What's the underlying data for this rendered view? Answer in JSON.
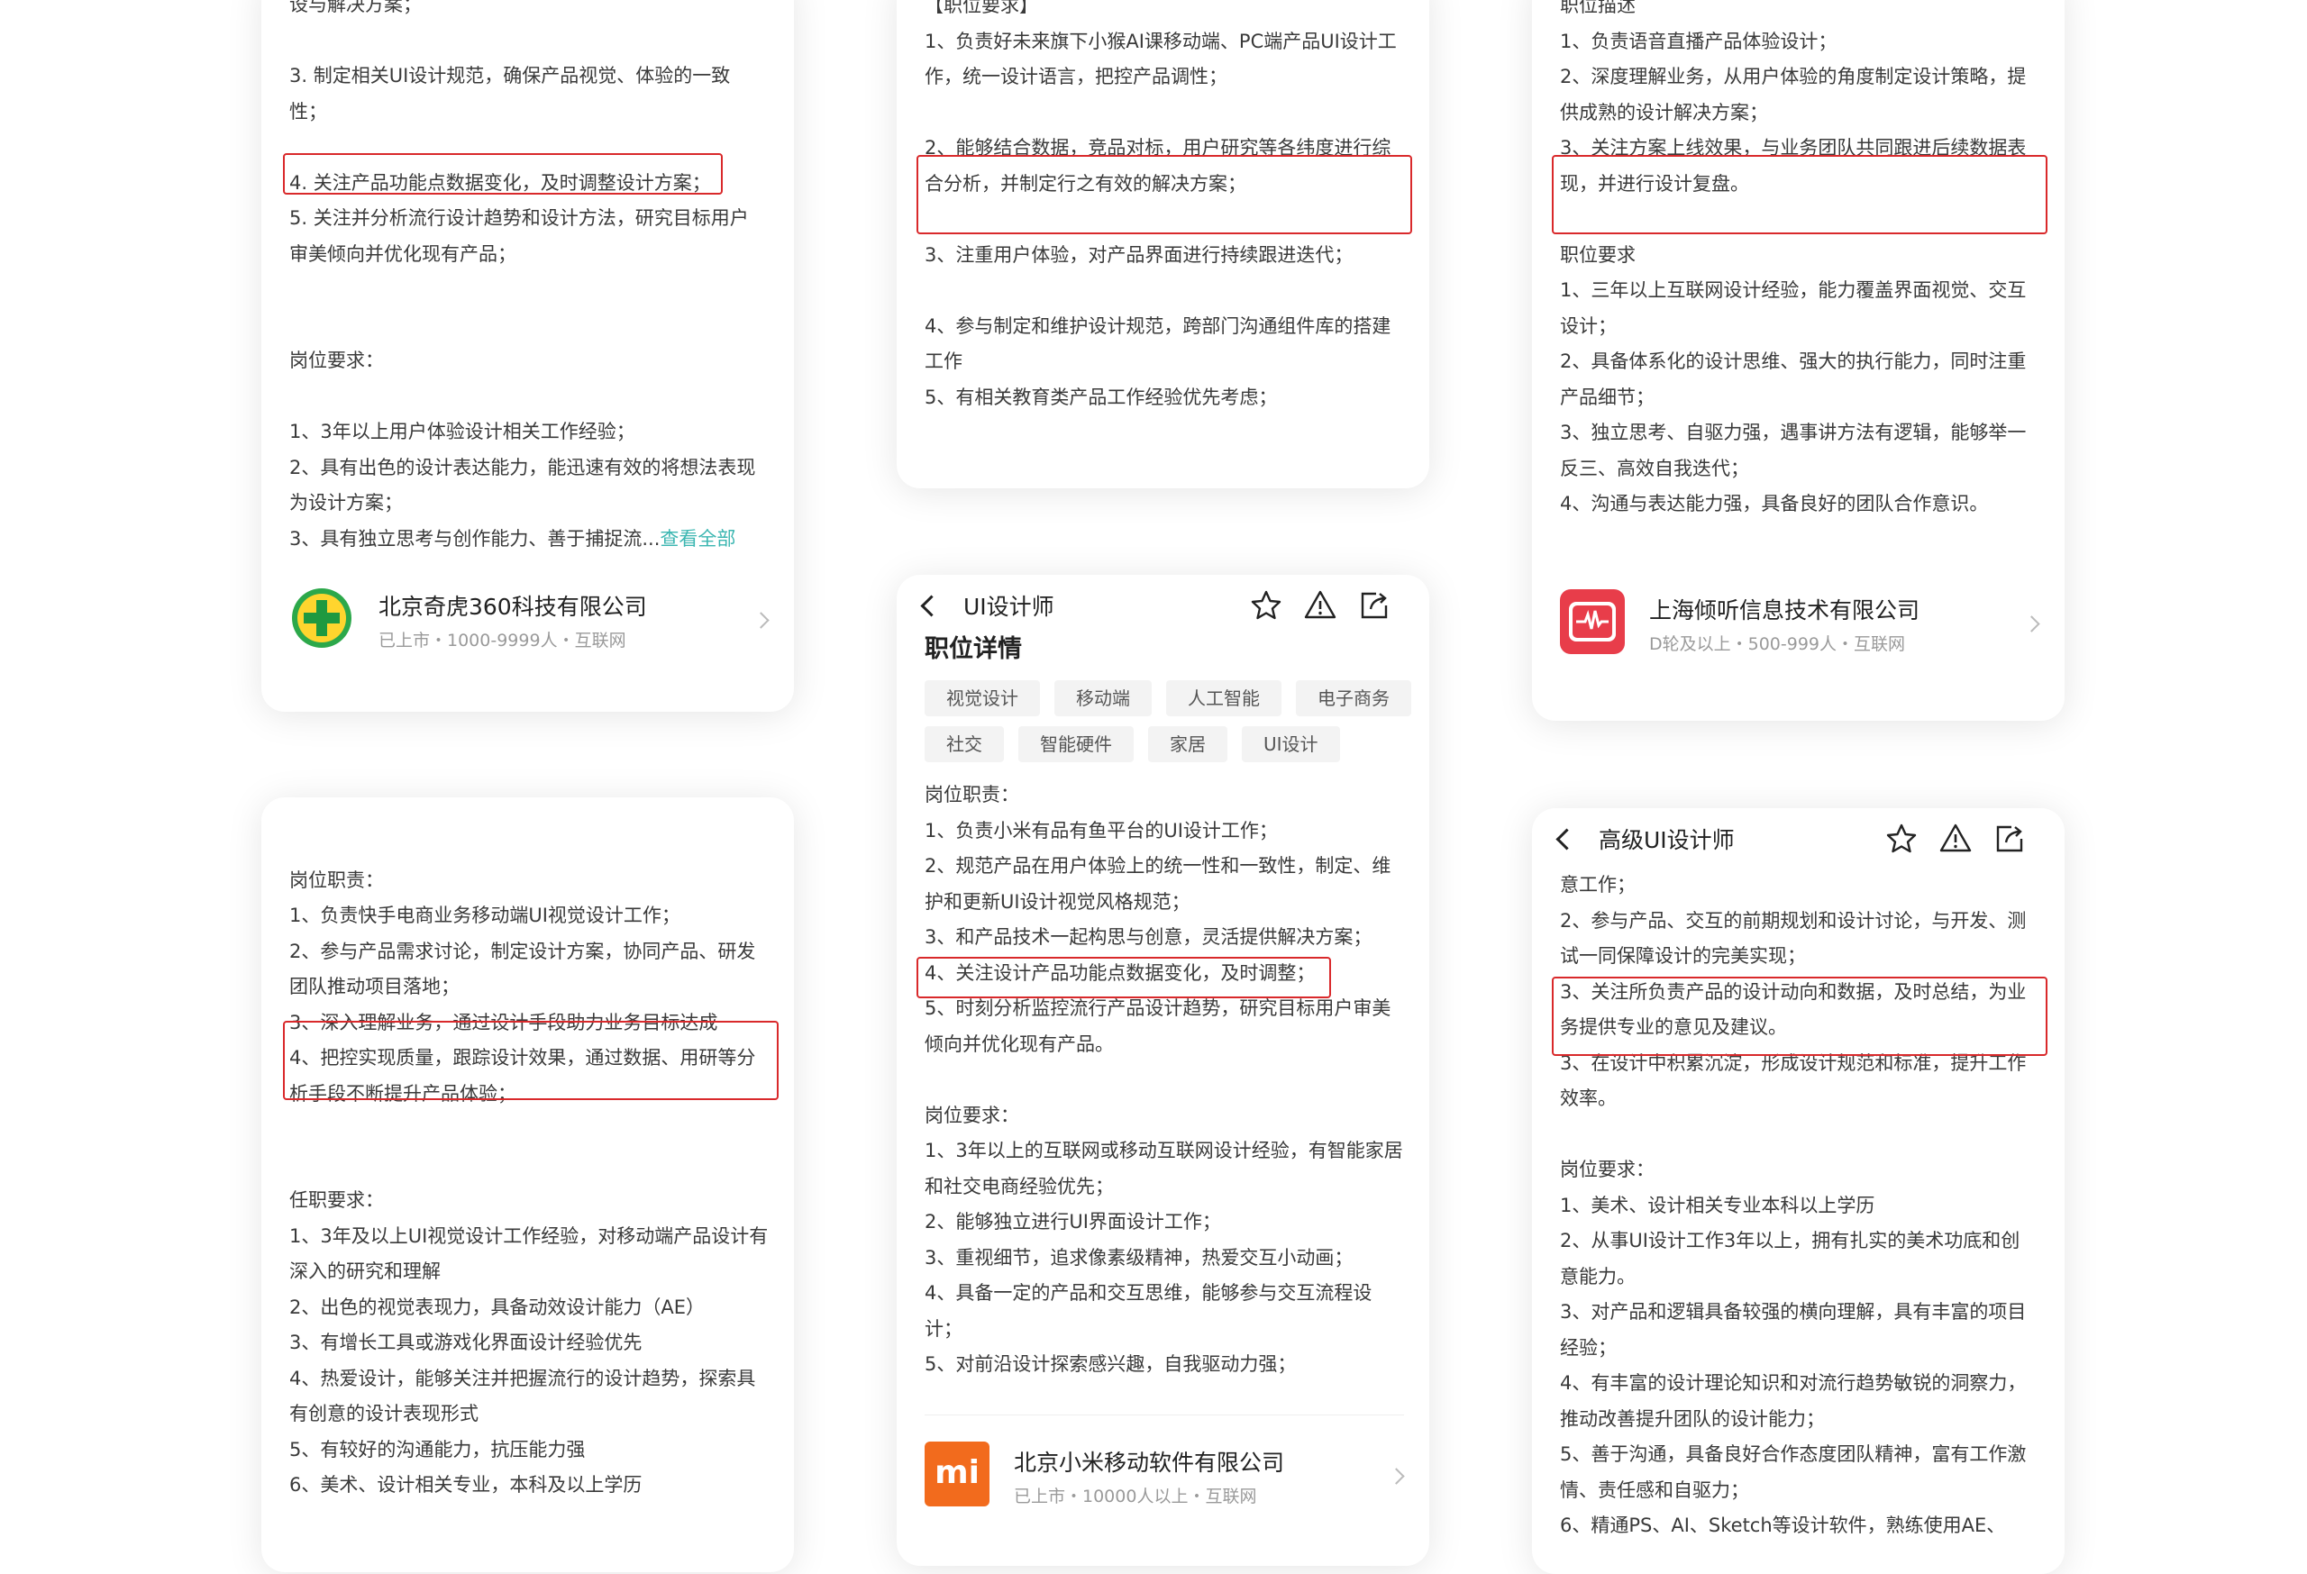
{
  "card1": {
    "lines": [
      "设与解决方案；",
      "",
      "3. 制定相关UI设计规范，确保产品视觉、体验的一致",
      "性；",
      "",
      "4. 关注产品功能点数据变化，及时调整设计方案；",
      "5. 关注并分析流行设计趋势和设计方法，研究目标用户",
      "审美倾向并优化现有产品；",
      "",
      "",
      "岗位要求：",
      "",
      "1、3年以上用户体验设计相关工作经验；",
      "2、具有出色的设计表达能力，能迅速有效的将想法表现",
      "为设计方案；"
    ],
    "last_line": "3、具有独立思考与创作能力、善于捕捉流...",
    "more_link": "查看全部",
    "company_name": "北京奇虎360科技有限公司",
    "company_meta": "已上市・1000-9999人・互联网"
  },
  "card2": {
    "lines": [
      "【职位要求】",
      "1、负责好未来旗下小猴AI课移动端、PC端产品UI设计工",
      "作，统一设计语言，把控产品调性；",
      "",
      "2、能够结合数据，竞品对标，用户研究等各纬度进行综",
      "合分析，并制定行之有效的解决方案；",
      "",
      "3、注重用户体验，对产品界面进行持续跟进迭代；",
      "",
      "4、参与制定和维护设计规范，跨部门沟通组件库的搭建",
      "工作",
      "5、有相关教育类产品工作经验优先考虑；"
    ]
  },
  "card3": {
    "lines": [
      "职位描述",
      "1、负责语音直播产品体验设计；",
      "2、深度理解业务，从用户体验的角度制定设计策略，提",
      "供成熟的设计解决方案；",
      "3、关注方案上线效果，与业务团队共同跟进后续数据表",
      "现，并进行设计复盘。",
      "",
      "职位要求",
      "1、三年以上互联网设计经验，能力覆盖界面视觉、交互",
      "设计；",
      "2、具备体系化的设计思维、强大的执行能力，同时注重",
      "产品细节；",
      "3、独立思考、自驱力强，遇事讲方法有逻辑，能够举一",
      "反三、高效自我迭代；",
      "4、沟通与表达能力强，具备良好的团队合作意识。"
    ],
    "company_name": "上海倾听信息技术有限公司",
    "company_meta": "D轮及以上・500-999人・互联网"
  },
  "card4": {
    "nav_title": "UI设计师",
    "section_title": "职位详情",
    "tags_row1": [
      "视觉设计",
      "移动端",
      "人工智能",
      "电子商务"
    ],
    "tags_row2": [
      "社交",
      "智能硬件",
      "家居",
      "UI设计"
    ],
    "lines": [
      "岗位职责：",
      "1、负责小米有品有鱼平台的UI设计工作；",
      "2、规范产品在用户体验上的统一性和一致性，制定、维",
      "护和更新UI设计视觉风格规范；",
      "3、和产品技术一起构思与创意，灵活提供解决方案；",
      "4、关注设计产品功能点数据变化，及时调整；",
      "5、时刻分析监控流行产品设计趋势，研究目标用户审美",
      "倾向并优化现有产品。",
      "",
      "岗位要求：",
      "1、3年以上的互联网或移动互联网设计经验，有智能家居",
      "和社交电商经验优先；",
      "2、能够独立进行UI界面设计工作；",
      "3、重视细节，追求像素级精神，热爱交互小动画；",
      "4、具备一定的产品和交互思维，能够参与交互流程设",
      "计；",
      "5、对前沿设计探索感兴趣，自我驱动力强；"
    ],
    "company_name": "北京小米移动软件有限公司",
    "company_meta": "已上市・10000人以上・互联网",
    "logo_text": "mi"
  },
  "card5": {
    "lines": [
      "",
      "岗位职责：",
      "1、负责快手电商业务移动端UI视觉设计工作；",
      "2、参与产品需求讨论，制定设计方案，协同产品、研发",
      "团队推动项目落地；",
      "3、深入理解业务，通过设计手段助力业务目标达成",
      "4、把控实现质量，跟踪设计效果，通过数据、用研等分",
      "析手段不断提升产品体验；",
      "",
      "",
      "任职要求：",
      "1、3年及以上UI视觉设计工作经验，对移动端产品设计有",
      "深入的研究和理解",
      "2、出色的视觉表现力，具备动效设计能力（AE）",
      "3、有增长工具或游戏化界面设计经验优先",
      "4、热爱设计，能够关注并把握流行的设计趋势，探索具",
      "有创意的设计表现形式",
      "5、有较好的沟通能力，抗压能力强",
      "6、美术、设计相关专业，本科及以上学历"
    ]
  },
  "card6": {
    "nav_title": "高级UI设计师",
    "lines": [
      "意工作；",
      "2、参与产品、交互的前期规划和设计讨论，与开发、测",
      "试一同保障设计的完美实现；",
      "3、关注所负责产品的设计动向和数据，及时总结，为业",
      "务提供专业的意见及建议。",
      "3、在设计中积累沉淀，形成设计规范和标准，提升工作",
      "效率。",
      "",
      "岗位要求：",
      "1、美术、设计相关专业本科以上学历",
      "2、从事UI设计工作3年以上，拥有扎实的美术功底和创",
      "意能力。",
      "3、对产品和逻辑具备较强的横向理解，具有丰富的项目",
      "经验；",
      "4、有丰富的设计理论知识和对流行趋势敏锐的洞察力，",
      "推动改善提升团队的设计能力；",
      "5、善于沟通，具备良好合作态度团队精神，富有工作激",
      "情、责任感和自驱力；",
      "6、精通PS、AI、Sketch等设计软件，熟练使用AE、"
    ]
  },
  "colors": {
    "highlight": "#d9292b",
    "link": "#3bb6b1",
    "mi": "#f26b1d",
    "qingting": "#e83d4a"
  }
}
